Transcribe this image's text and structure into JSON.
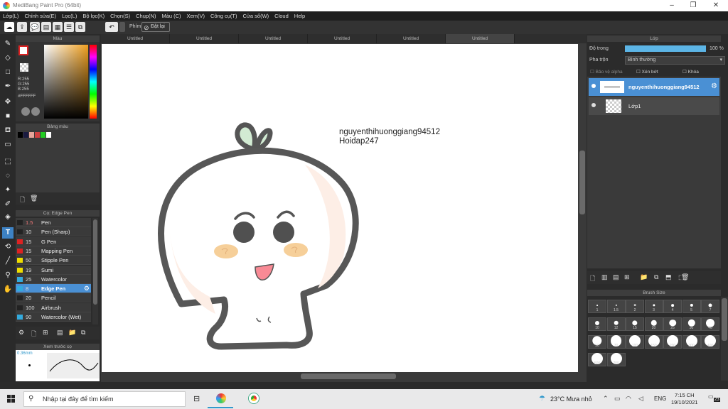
{
  "app": {
    "title": "MediBang Paint Pro (64bit)"
  },
  "menu": [
    "Lớp(L)",
    "Chỉnh sửa(E)",
    "Lọc(L)",
    "Bộ lọc(K)",
    "Chọn(S)",
    "Chụp(N)",
    "Màu (C)",
    "Xem(V)",
    "Công cụ(T)",
    "Cửa sổ(W)",
    "Cloud",
    "Help"
  ],
  "toolbar": {
    "snap_label": "Phím",
    "reset_label": "Đặt lại"
  },
  "color_panel": {
    "title": "Màu",
    "r": "R:255",
    "g": "G:255",
    "b": "B:255",
    "hex": "#FFFFFF"
  },
  "palette": {
    "title": "Bảng màu",
    "colors": [
      "#000000",
      "#1a1a40",
      "#e7a59a",
      "#d04040",
      "#22cc22",
      "#ffffff"
    ]
  },
  "brush_panel": {
    "title": "Cọ: Edge Pen",
    "items": [
      {
        "size": "1.5",
        "name": "Pen",
        "color": "#222222"
      },
      {
        "size": "10",
        "name": "Pen (Sharp)",
        "color": "#222222"
      },
      {
        "size": "15",
        "name": "G Pen",
        "color": "#dd2222"
      },
      {
        "size": "15",
        "name": "Mapping Pen",
        "color": "#dd2222"
      },
      {
        "size": "50",
        "name": "Stipple Pen",
        "color": "#eedd00"
      },
      {
        "size": "19",
        "name": "Sumi",
        "color": "#eedd00"
      },
      {
        "size": "25",
        "name": "Watercolor",
        "color": "#33aadd"
      },
      {
        "size": "8",
        "name": "Edge Pen",
        "color": "#33aadd",
        "selected": true
      },
      {
        "size": "20",
        "name": "Pencil",
        "color": "#222222"
      },
      {
        "size": "100",
        "name": "Airbrush",
        "color": "#222222"
      },
      {
        "size": "90",
        "name": "Watercolor (Wet)",
        "color": "#33aadd"
      }
    ]
  },
  "preview": {
    "title": "Xem trước cọ",
    "size": "0.36mm"
  },
  "tabs": [
    "Untitled",
    "Untitled",
    "Untitled",
    "Untitled",
    "Untitled",
    "Untitled"
  ],
  "canvas_text": {
    "line1": "nguyenthihuonggiang94512",
    "line2": "Hoidap247"
  },
  "layer_panel": {
    "title": "Lớp",
    "opacity_label": "Độ trong",
    "opacity_value": "100 %",
    "opacity": 1.0,
    "blend_label": "Pha trộn",
    "blend_value": "Bình thường",
    "protect_alpha": "Bảo vệ alpha",
    "clipping": "Xén bớt",
    "lock": "Khóa",
    "layers": [
      {
        "name": "nguyenthihuonggiang94512",
        "selected": true
      },
      {
        "name": "Lớp1",
        "selected": false
      }
    ]
  },
  "brush_size": {
    "title": "Brush Size",
    "sizes": [
      "1",
      "1.5",
      "2",
      "3",
      "4",
      "5",
      "7",
      "10",
      "12",
      "15",
      "20",
      "25",
      "30",
      "40",
      "50",
      "70",
      "100",
      "150",
      "200",
      "300",
      "400",
      "500",
      "700"
    ]
  },
  "taskbar": {
    "search_placeholder": "Nhập tại đây để tìm kiếm",
    "weather": "23°C  Mưa nhỏ",
    "lang": "ENG",
    "time": "7:15 CH",
    "date": "19/10/2021",
    "notif": "23"
  }
}
